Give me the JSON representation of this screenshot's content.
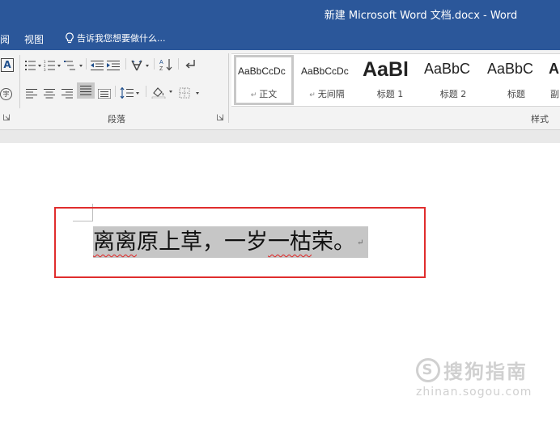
{
  "window": {
    "title": "新建 Microsoft Word 文档.docx - Word"
  },
  "menu": {
    "partial_tab": "阅",
    "view_tab": "视图",
    "tell_me_placeholder": "告诉我您想要做什么..."
  },
  "ribbon": {
    "font_partial": {
      "a_box": "A",
      "circle": "字"
    },
    "paragraph_group_label": "段落",
    "styles_group_label": "样式",
    "styles": [
      {
        "sample": "AaBbCcDc",
        "name": "正文",
        "selected": true
      },
      {
        "sample": "AaBbCcDc",
        "name": "无间隔"
      },
      {
        "sample": "AaBl",
        "name": "标题 1"
      },
      {
        "sample": "AaBbC",
        "name": "标题 2"
      },
      {
        "sample": "AaBbC",
        "name": "标题"
      },
      {
        "sample": "A",
        "name": "副"
      }
    ]
  },
  "document": {
    "text_part1": "离离",
    "text_part2": "原上草，一岁",
    "text_part3": "一枯",
    "text_part4": "荣。",
    "paragraph_mark": "↵"
  },
  "watermark": {
    "line1": "搜狗指南",
    "line2": "zhinan.sogou.com",
    "logo": "S"
  },
  "colors": {
    "accent": "#2b579a",
    "highlight_border": "#e02d2d",
    "selection": "#c6c6c6"
  }
}
